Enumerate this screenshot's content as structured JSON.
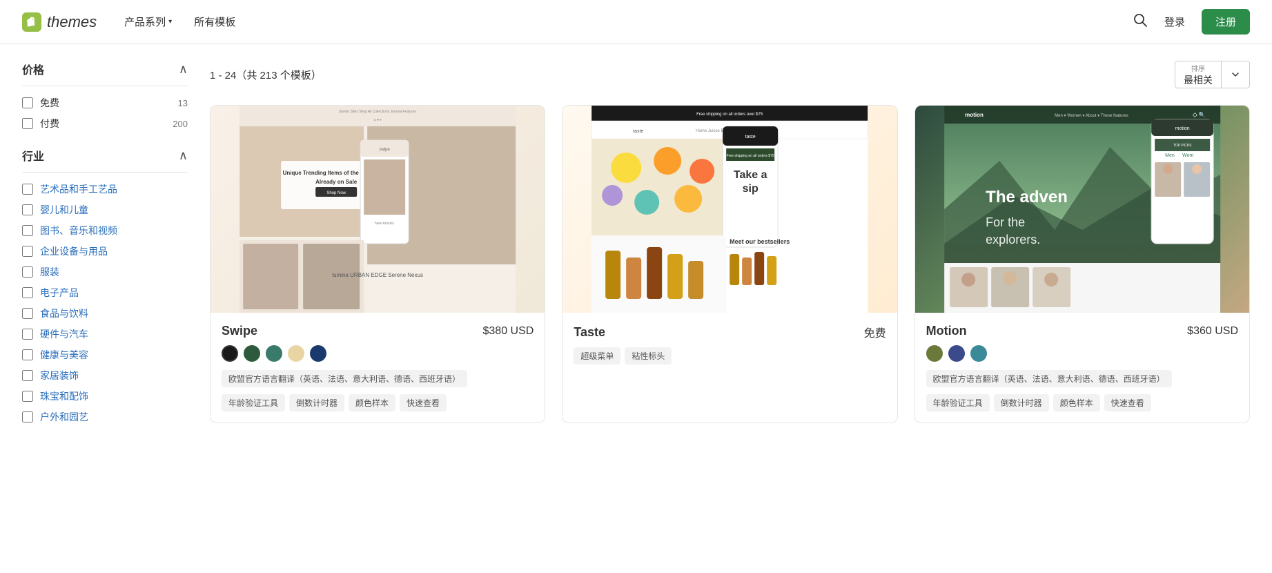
{
  "nav": {
    "logo_text": "themes",
    "links": [
      {
        "id": "products",
        "label": "产品系列",
        "has_dropdown": true
      },
      {
        "id": "all-templates",
        "label": "所有模板",
        "has_dropdown": false
      }
    ],
    "login_label": "登录",
    "register_label": "注册"
  },
  "sidebar": {
    "price_section": {
      "title": "价格",
      "options": [
        {
          "id": "free",
          "label": "免费",
          "count": "13"
        },
        {
          "id": "paid",
          "label": "付费",
          "count": "200"
        }
      ]
    },
    "industry_section": {
      "title": "行业",
      "options": [
        {
          "id": "arts-crafts",
          "label": "艺术品和手工艺品"
        },
        {
          "id": "baby-kids",
          "label": "婴儿和儿童"
        },
        {
          "id": "books-music-video",
          "label": "图书、音乐和视频"
        },
        {
          "id": "business-equipment",
          "label": "企业设备与用品"
        },
        {
          "id": "clothing",
          "label": "服装"
        },
        {
          "id": "electronics",
          "label": "电子产品"
        },
        {
          "id": "food-beverage",
          "label": "食品与饮料"
        },
        {
          "id": "hardware-auto",
          "label": "硬件与汽车"
        },
        {
          "id": "health-beauty",
          "label": "健康与美容"
        },
        {
          "id": "home-decor",
          "label": "家居装饰"
        },
        {
          "id": "jewelry-accessories",
          "label": "珠宝和配饰"
        },
        {
          "id": "outdoor-garden",
          "label": "户外和园艺"
        }
      ]
    }
  },
  "results": {
    "count_text": "1 - 24（共 213 个模板）",
    "sort": {
      "label": "排序",
      "value": "最相关"
    }
  },
  "themes": [
    {
      "id": "swipe",
      "name": "Swipe",
      "price": "$380 USD",
      "free": false,
      "swatches": [
        {
          "color": "#1a1a1a",
          "selected": true
        },
        {
          "color": "#2d5a3d",
          "selected": false
        },
        {
          "color": "#3a7a6a",
          "selected": false
        },
        {
          "color": "#e8d5a3",
          "selected": false
        },
        {
          "color": "#1a3a6e",
          "selected": false
        }
      ],
      "description_tag": "欧盟官方语言翻译（英语、法语、意大利语、德语、西班牙语）",
      "feature_tags": [
        "年龄验证工具",
        "倒数计时器",
        "颜色样本",
        "快速查看"
      ]
    },
    {
      "id": "taste",
      "name": "Taste",
      "price": "免费",
      "free": true,
      "swatches": [],
      "description_tag": "",
      "feature_tags": [
        "超级菜单",
        "粘性标头"
      ]
    },
    {
      "id": "motion",
      "name": "Motion",
      "price": "$360 USD",
      "free": false,
      "swatches": [
        {
          "color": "#6b7a3a",
          "selected": false
        },
        {
          "color": "#3a4a8a",
          "selected": false
        },
        {
          "color": "#3a8a9a",
          "selected": false
        }
      ],
      "description_tag": "欧盟官方语言翻译（英语、法语、意大利语、德语、西班牙语）",
      "feature_tags": [
        "年龄验证工具",
        "倒数计时器",
        "颜色样本",
        "快速查看"
      ]
    }
  ]
}
